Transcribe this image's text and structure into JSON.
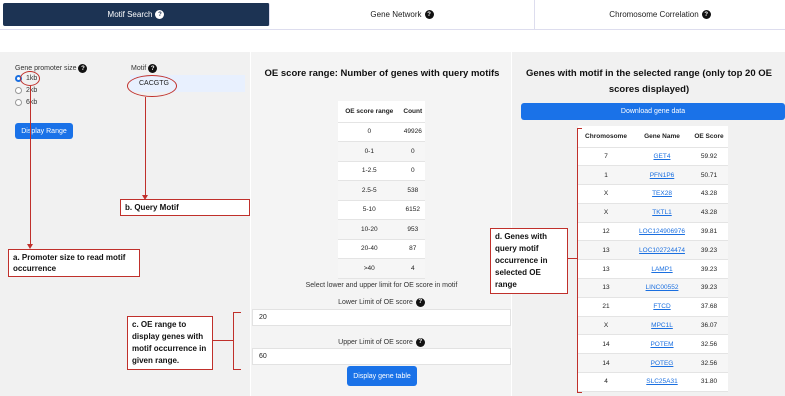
{
  "tabs": [
    {
      "label": "Motif Search",
      "help": "?"
    },
    {
      "label": "Gene Network",
      "help": "?"
    },
    {
      "label": "Chromosome Correlation",
      "help": "?"
    }
  ],
  "left": {
    "promoter_label": "Gene promoter size",
    "help": "?",
    "options": [
      "1kb",
      "2kb",
      "6kb"
    ],
    "selected_option": "1kb",
    "motif_label": "Motif",
    "motif_value": "CACGTG",
    "display_range_button": "Display Range"
  },
  "middle": {
    "title": "OE score range: Number of genes with query motifs",
    "table_headers": [
      "OE score range",
      "Count"
    ],
    "rows": [
      [
        "0",
        "49926"
      ],
      [
        "0-1",
        "0"
      ],
      [
        "1-2.5",
        "0"
      ],
      [
        "2.5-5",
        "538"
      ],
      [
        "5-10",
        "6152"
      ],
      [
        "10-20",
        "953"
      ],
      [
        "20-40",
        "87"
      ],
      [
        ">40",
        "4"
      ]
    ],
    "select_hint": "Select lower and upper limit for OE score in motif",
    "lower_label": "Lower Limit of OE score",
    "lower_value": "20",
    "upper_label": "Upper Limit of OE score",
    "upper_value": "60",
    "help": "?",
    "display_table_button": "Display gene table"
  },
  "right": {
    "title": "Genes with motif in the selected range (only top 20 OE scores displayed)",
    "download_button": "Download gene data",
    "table_headers": [
      "Chromosome",
      "Gene Name",
      "OE Score"
    ],
    "rows": [
      [
        "7",
        "GET4",
        "59.92"
      ],
      [
        "1",
        "PFN1P6",
        "50.71"
      ],
      [
        "X",
        "TEX28",
        "43.28"
      ],
      [
        "X",
        "TKTL1",
        "43.28"
      ],
      [
        "12",
        "LOC124906976",
        "39.81"
      ],
      [
        "13",
        "LOC102724474",
        "39.23"
      ],
      [
        "13",
        "LAMP1",
        "39.23"
      ],
      [
        "13",
        "LINC00552",
        "39.23"
      ],
      [
        "21",
        "FTCD",
        "37.68"
      ],
      [
        "X",
        "MPC1L",
        "36.07"
      ],
      [
        "14",
        "POTEM",
        "32.56"
      ],
      [
        "14",
        "POTEG",
        "32.56"
      ],
      [
        "4",
        "SLC25A31",
        "31.80"
      ]
    ]
  },
  "annotations": {
    "a": "a. Promoter size to read motif occurrence",
    "b": "b. Query Motif",
    "c": "c. OE range to display genes with motif occurrence in given range.",
    "d": "d. Genes with query motif occurrence in selected OE range"
  },
  "colors": {
    "accent": "#1a72e8",
    "active_tab": "#1c3353",
    "annotation": "#c0302b"
  }
}
